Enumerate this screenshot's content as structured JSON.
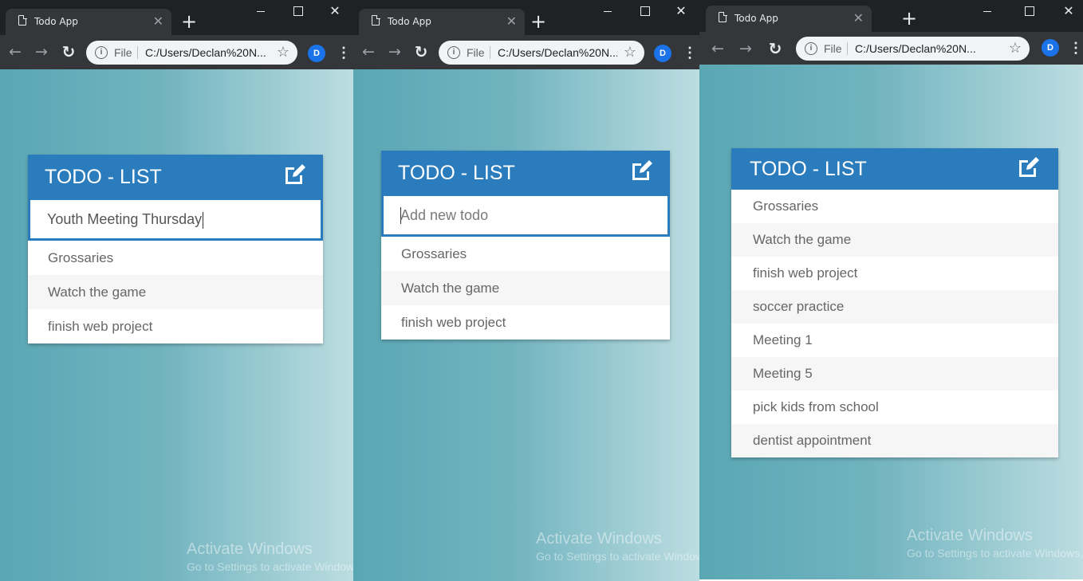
{
  "browser": {
    "tab_title": "Todo App",
    "url": "C:/Users/Declan%20N...",
    "scheme_label": "File",
    "profile_initial": "D",
    "accent": "#2a7cbc"
  },
  "app": {
    "title": "TODO - LIST",
    "input_placeholder": "Add new todo"
  },
  "windows": [
    {
      "input_value": "Youth Meeting Thursday",
      "todos": [
        "Grossaries",
        "Watch the game",
        "finish web project"
      ]
    },
    {
      "input_value": "",
      "todos": [
        "Grossaries",
        "Watch the game",
        "finish web project"
      ]
    },
    {
      "todos": [
        "Grossaries",
        "Watch the game",
        "finish web project",
        "soccer practice",
        "Meeting 1",
        "Meeting 5",
        "pick kids from school",
        "dentist appointment"
      ]
    }
  ],
  "watermark": {
    "line1": "Activate Windows",
    "line2": "Go to Settings to activate Windows."
  }
}
